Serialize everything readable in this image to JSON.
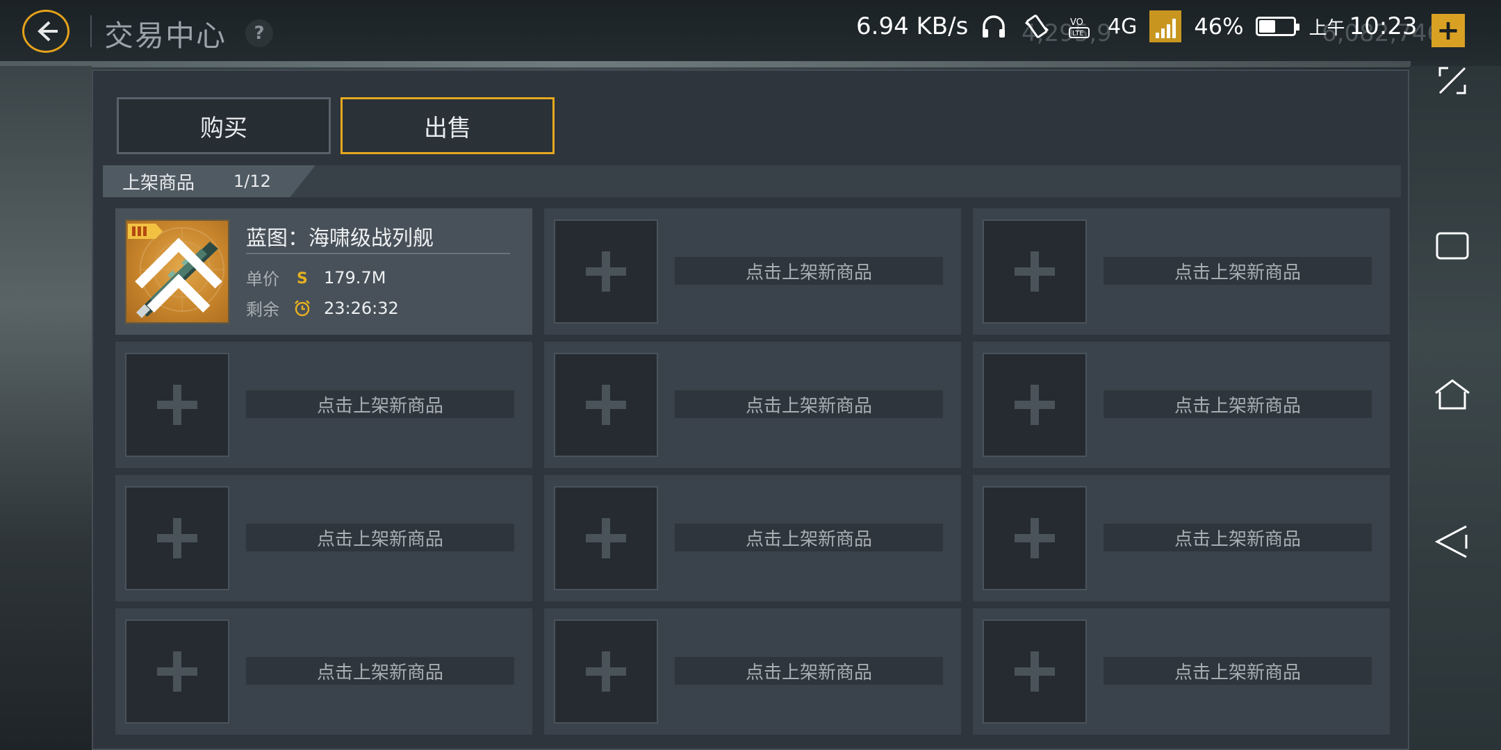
{
  "header": {
    "title": "交易中心",
    "help_label": "?"
  },
  "status_bar": {
    "net_speed": "6.94 KB/s",
    "net_type": "4G",
    "battery_percent": "46%",
    "battery_level": 0.46,
    "time_prefix": "上午",
    "time": "10:23",
    "currency_1": "4,295,9",
    "currency_2": "6,082,746",
    "add_label": "+"
  },
  "tabs": [
    {
      "label": "购买",
      "active": false
    },
    {
      "label": "出售",
      "active": true
    }
  ],
  "listing": {
    "label": "上架商品",
    "count": "1/12"
  },
  "item": {
    "name": "蓝图：海啸级战列舰",
    "price_label": "单价",
    "price": "179.7M",
    "remaining_label": "剩余",
    "remaining": "23:26:32"
  },
  "empty_slot_label": "点击上架新商品",
  "colors": {
    "accent": "#e6a81d",
    "panel": "#2e353c",
    "slot": "#3a424b"
  }
}
